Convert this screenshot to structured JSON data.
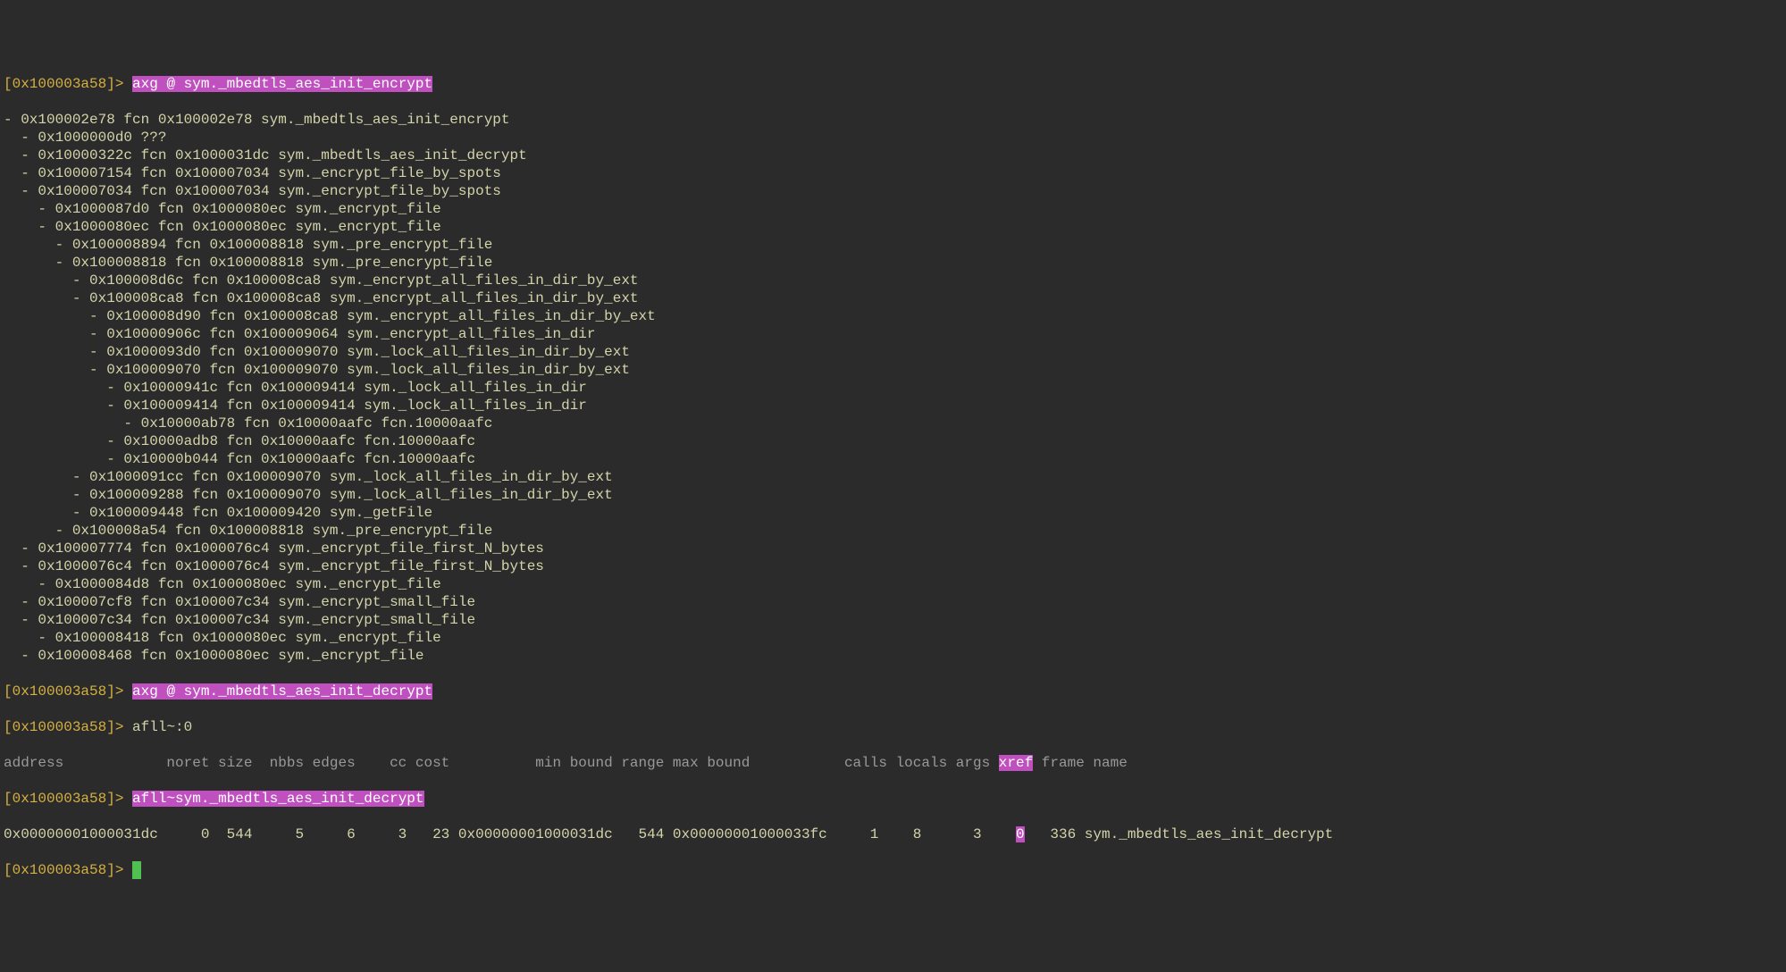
{
  "prompt1": {
    "addr": "[0x100003a58]",
    "gt": ">",
    "cmd": "axg @ sym._mbedtls_aes_init_encrypt"
  },
  "tree": [
    "- 0x100002e78 fcn 0x100002e78 sym._mbedtls_aes_init_encrypt",
    "  - 0x1000000d0 ???",
    "  - 0x10000322c fcn 0x1000031dc sym._mbedtls_aes_init_decrypt",
    "  - 0x100007154 fcn 0x100007034 sym._encrypt_file_by_spots",
    "  - 0x100007034 fcn 0x100007034 sym._encrypt_file_by_spots",
    "    - 0x1000087d0 fcn 0x1000080ec sym._encrypt_file",
    "    - 0x1000080ec fcn 0x1000080ec sym._encrypt_file",
    "      - 0x100008894 fcn 0x100008818 sym._pre_encrypt_file",
    "      - 0x100008818 fcn 0x100008818 sym._pre_encrypt_file",
    "        - 0x100008d6c fcn 0x100008ca8 sym._encrypt_all_files_in_dir_by_ext",
    "        - 0x100008ca8 fcn 0x100008ca8 sym._encrypt_all_files_in_dir_by_ext",
    "          - 0x100008d90 fcn 0x100008ca8 sym._encrypt_all_files_in_dir_by_ext",
    "          - 0x10000906c fcn 0x100009064 sym._encrypt_all_files_in_dir",
    "          - 0x1000093d0 fcn 0x100009070 sym._lock_all_files_in_dir_by_ext",
    "          - 0x100009070 fcn 0x100009070 sym._lock_all_files_in_dir_by_ext",
    "            - 0x10000941c fcn 0x100009414 sym._lock_all_files_in_dir",
    "            - 0x100009414 fcn 0x100009414 sym._lock_all_files_in_dir",
    "              - 0x10000ab78 fcn 0x10000aafc fcn.10000aafc",
    "            - 0x10000adb8 fcn 0x10000aafc fcn.10000aafc",
    "            - 0x10000b044 fcn 0x10000aafc fcn.10000aafc",
    "        - 0x1000091cc fcn 0x100009070 sym._lock_all_files_in_dir_by_ext",
    "        - 0x100009288 fcn 0x100009070 sym._lock_all_files_in_dir_by_ext",
    "        - 0x100009448 fcn 0x100009420 sym._getFile",
    "      - 0x100008a54 fcn 0x100008818 sym._pre_encrypt_file",
    "  - 0x100007774 fcn 0x1000076c4 sym._encrypt_file_first_N_bytes",
    "  - 0x1000076c4 fcn 0x1000076c4 sym._encrypt_file_first_N_bytes",
    "    - 0x1000084d8 fcn 0x1000080ec sym._encrypt_file",
    "  - 0x100007cf8 fcn 0x100007c34 sym._encrypt_small_file",
    "  - 0x100007c34 fcn 0x100007c34 sym._encrypt_small_file",
    "    - 0x100008418 fcn 0x1000080ec sym._encrypt_file",
    "  - 0x100008468 fcn 0x1000080ec sym._encrypt_file"
  ],
  "prompt2": {
    "addr": "[0x100003a58]",
    "gt": ">",
    "cmd": "axg @ sym._mbedtls_aes_init_decrypt"
  },
  "prompt3": {
    "addr": "[0x100003a58]",
    "gt": ">",
    "cmd": "afll~:0"
  },
  "header": {
    "pre": "address            noret size  nbbs edges    cc cost          min bound range max bound           calls locals args ",
    "xref": "xref",
    "post": " frame name"
  },
  "prompt4": {
    "addr": "[0x100003a58]",
    "gt": ">",
    "cmd": "afll~sym._mbedtls_aes_init_decrypt"
  },
  "dataRow": {
    "pre": "0x00000001000031dc     0  544     5     6     3   23 0x00000001000031dc   544 0x00000001000033fc     1    8      3    ",
    "zero": "0",
    "post": "   336 sym._mbedtls_aes_init_decrypt"
  },
  "prompt5": {
    "addr": "[0x100003a58]",
    "gt": ">",
    "cursor": " "
  }
}
